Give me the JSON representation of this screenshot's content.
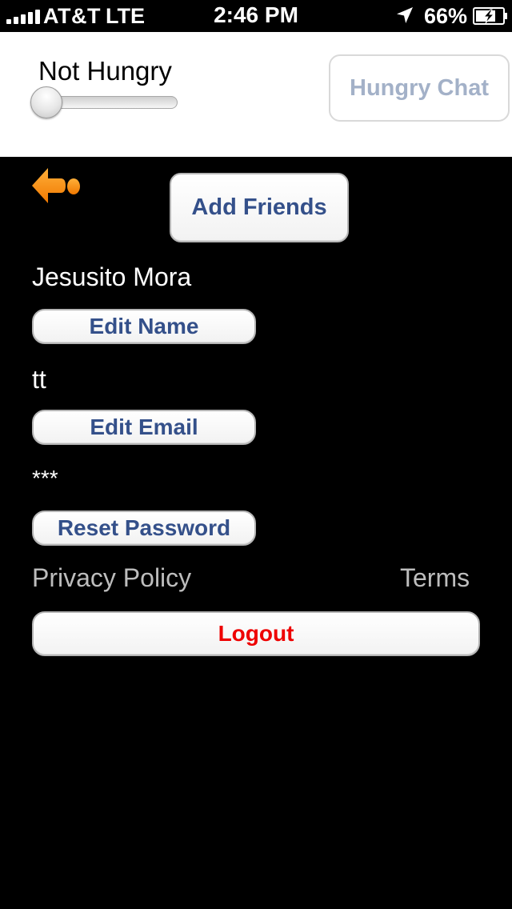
{
  "status_bar": {
    "carrier": "AT&T",
    "network": "LTE",
    "time": "2:46 PM",
    "battery": "66%",
    "icons": [
      "signal-icon",
      "location-arrow-icon",
      "battery-charging-icon"
    ]
  },
  "header": {
    "hunger_status": "Not Hungry",
    "hunger_slider_value": 0,
    "hungry_chat_label": "Hungry Chat"
  },
  "main": {
    "back_icon": "back-arrow-icon",
    "add_friends_label": "Add Friends",
    "user_name": "Jesusito Mora",
    "edit_name_label": "Edit Name",
    "user_email": "tt",
    "edit_email_label": "Edit Email",
    "password_masked": "***",
    "reset_password_label": "Reset Password",
    "privacy_policy_label": "Privacy Policy",
    "terms_label": "Terms",
    "logout_label": "Logout"
  },
  "colors": {
    "background": "#000000",
    "button_text": "#34508a",
    "hungry_chat_text": "#a3b1c8",
    "logout_text": "#ee0000",
    "link_text": "#bdbdbd",
    "back_icon": "#ff8a00"
  }
}
